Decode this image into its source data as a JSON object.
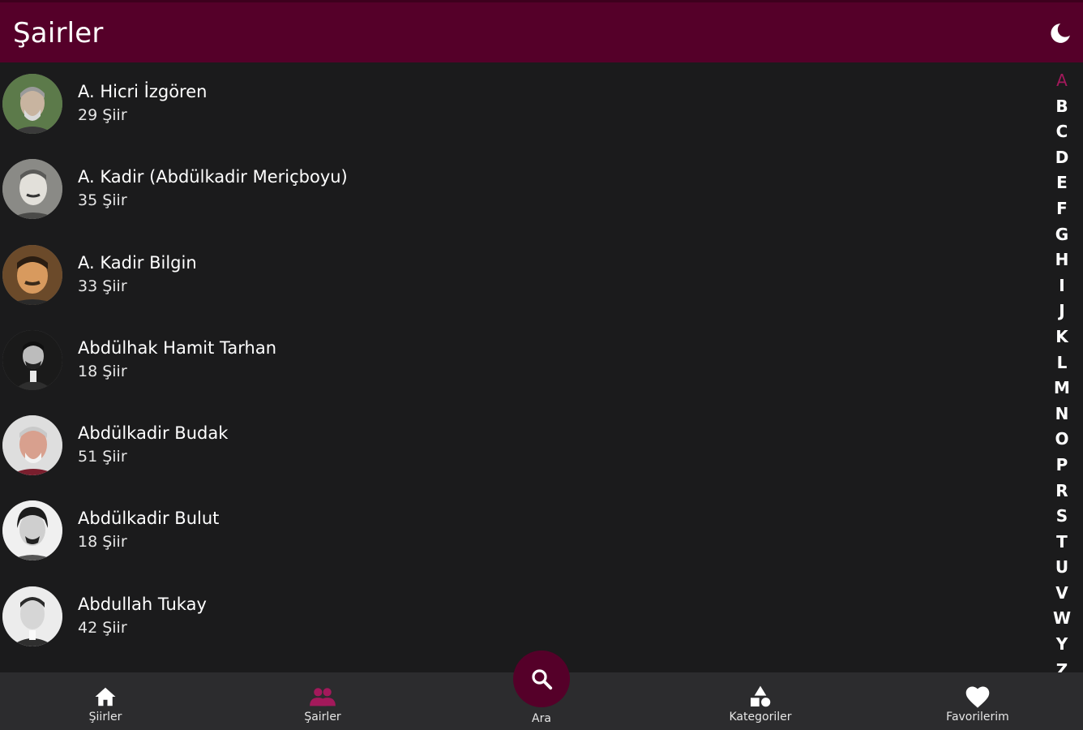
{
  "app": {
    "title": "Şairler",
    "accent_color": "#550029",
    "active_color": "#a3195b"
  },
  "icons": {
    "theme": "moon-icon",
    "search": "search-icon"
  },
  "poets": [
    {
      "name": "A. Hicri İzgören",
      "count": "29 Şiir"
    },
    {
      "name": "A. Kadir (Abdülkadir Meriçboyu)",
      "count": "35 Şiir"
    },
    {
      "name": "A. Kadir Bilgin",
      "count": "33 Şiir"
    },
    {
      "name": "Abdülhak Hamit Tarhan",
      "count": "18 Şiir"
    },
    {
      "name": "Abdülkadir Budak",
      "count": "51 Şiir"
    },
    {
      "name": "Abdülkadir Bulut",
      "count": "18 Şiir"
    },
    {
      "name": "Abdullah Tukay",
      "count": "42 Şiir"
    }
  ],
  "alphabet": [
    "A",
    "B",
    "C",
    "D",
    "E",
    "F",
    "G",
    "H",
    "I",
    "J",
    "K",
    "L",
    "M",
    "N",
    "O",
    "P",
    "R",
    "S",
    "T",
    "U",
    "V",
    "W",
    "Y",
    "Z"
  ],
  "alphabet_active": "A",
  "nav": {
    "home": "Şiirler",
    "poets": "Şairler",
    "search": "Ara",
    "categories": "Kategoriler",
    "favorites": "Favorilerim"
  }
}
